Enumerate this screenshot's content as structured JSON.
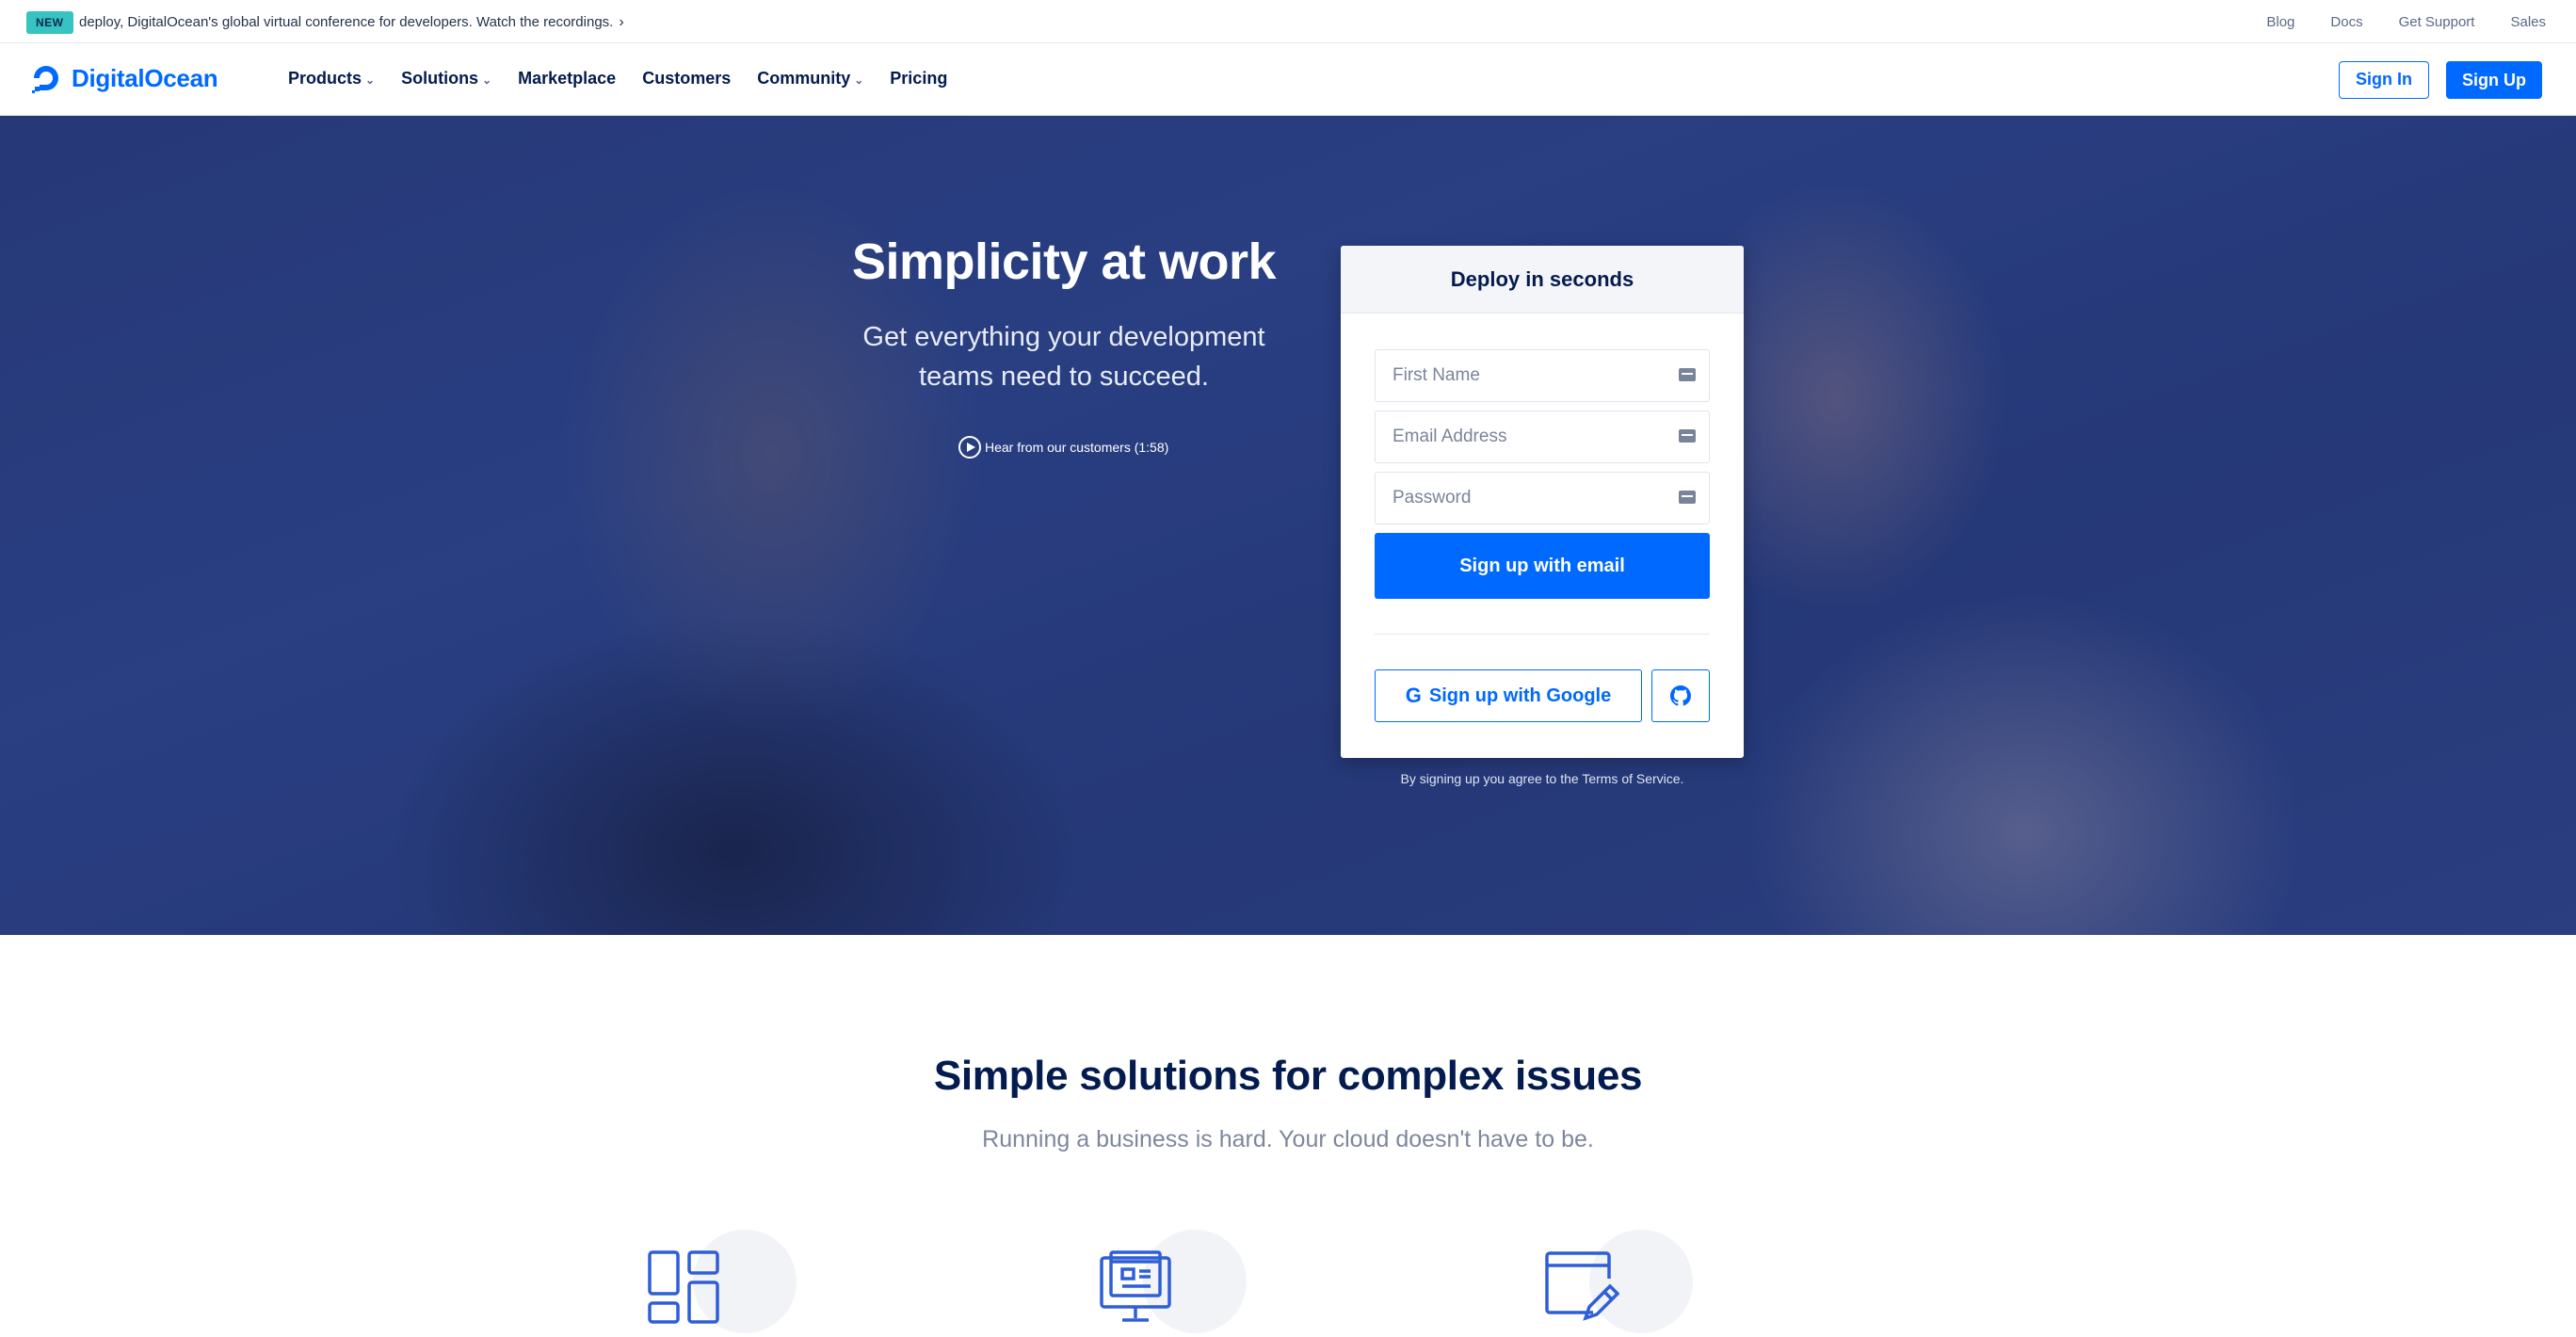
{
  "announcement": {
    "badge": "NEW",
    "text": "deploy, DigitalOcean's global virtual conference for developers. Watch the recordings.",
    "chevron": "›"
  },
  "top_links": [
    "Blog",
    "Docs",
    "Get Support",
    "Sales"
  ],
  "nav": {
    "logo_text": "DigitalOcean",
    "items": [
      {
        "label": "Products",
        "dropdown": true
      },
      {
        "label": "Solutions",
        "dropdown": true
      },
      {
        "label": "Marketplace",
        "dropdown": false
      },
      {
        "label": "Customers",
        "dropdown": false
      },
      {
        "label": "Community",
        "dropdown": true
      },
      {
        "label": "Pricing",
        "dropdown": false
      }
    ],
    "sign_in": "Sign In",
    "sign_up": "Sign Up"
  },
  "hero": {
    "title": "Simplicity at work",
    "subtitle": "Get everything your development teams need to succeed.",
    "video_link": "Hear from our customers (1:58)"
  },
  "signup_card": {
    "heading": "Deploy in seconds",
    "first_name_placeholder": "First Name",
    "email_placeholder": "Email Address",
    "password_placeholder": "Password",
    "email_button": "Sign up with email",
    "google_button": "Sign up with Google",
    "google_icon": "G",
    "terms": "By signing up you agree to the Terms of Service."
  },
  "section": {
    "title": "Simple solutions for complex issues",
    "subtitle": "Running a business is hard. Your cloud doesn't have to be."
  },
  "colors": {
    "brand": "#0069ff",
    "navy": "#031b4e",
    "badge": "#36c3c2"
  },
  "icons": [
    "dashboard-grid-icon",
    "monitor-browser-icon",
    "edit-window-icon",
    "github-icon",
    "play-circle-icon",
    "digitalocean-logo-icon"
  ]
}
